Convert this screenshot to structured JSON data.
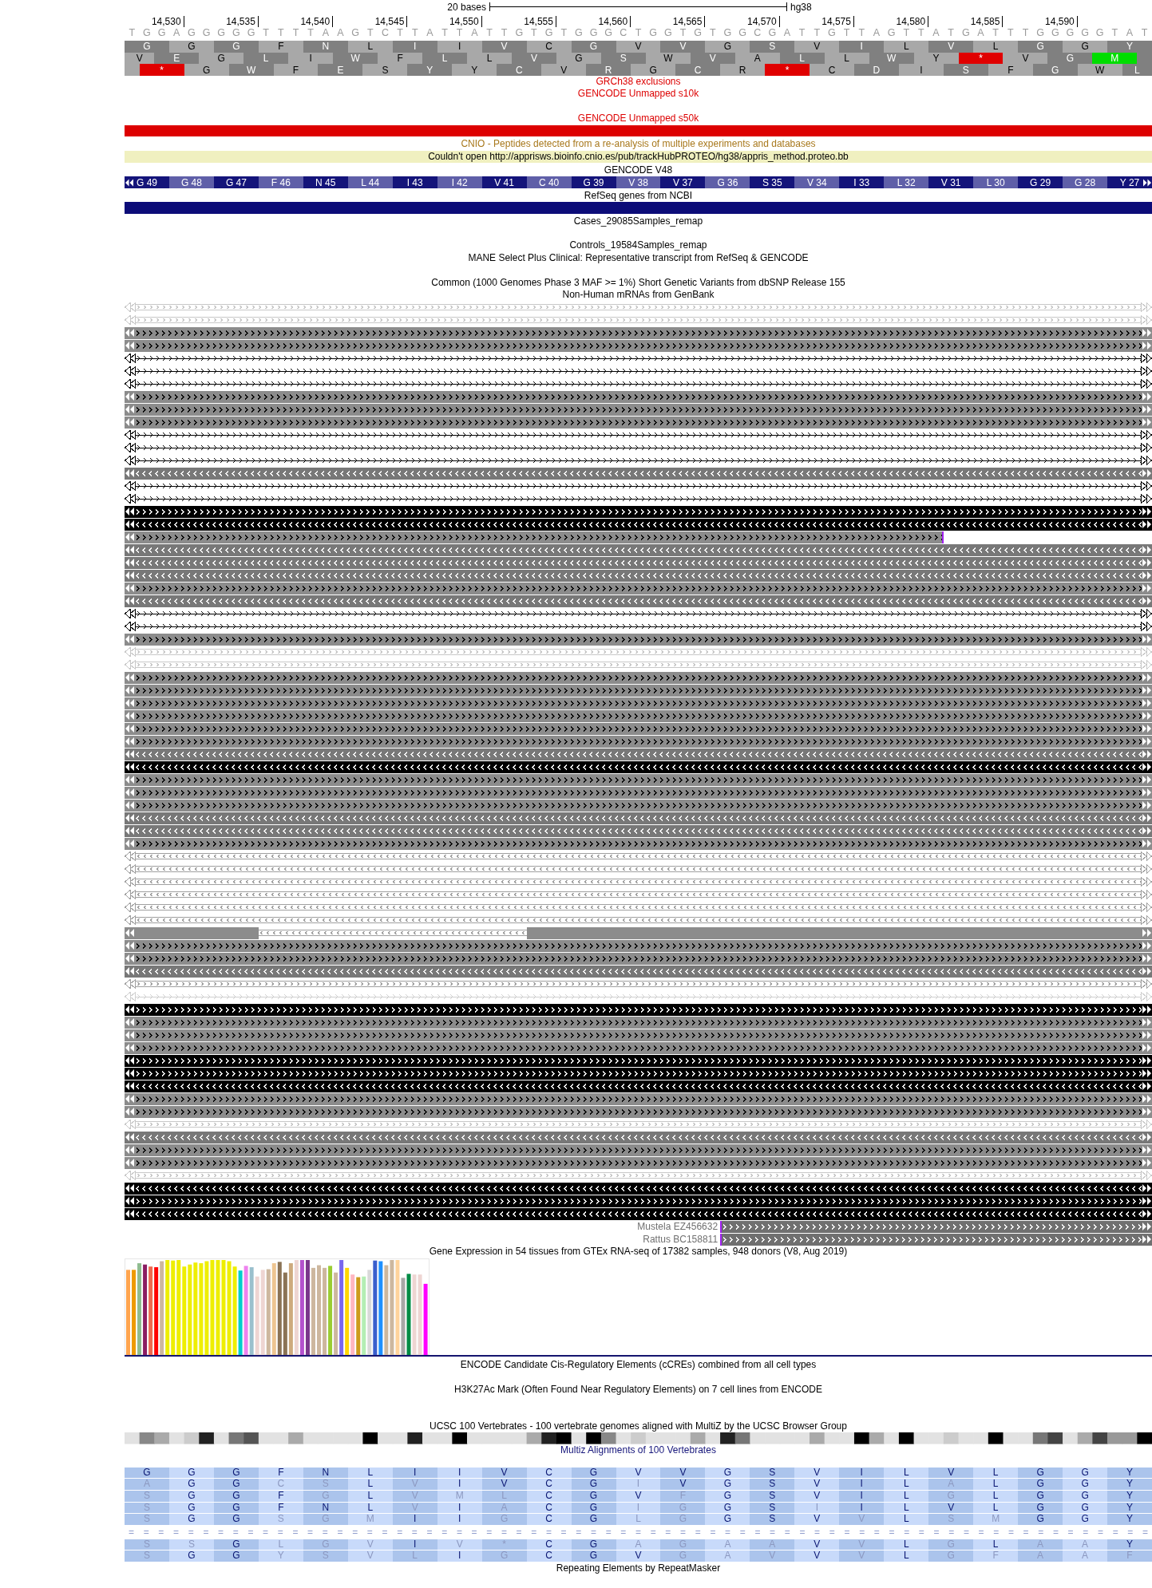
{
  "scale": {
    "label": "20 bases",
    "assembly": "hg38"
  },
  "ruler": [
    "14,530",
    "14,535",
    "14,540",
    "14,545",
    "14,550",
    "14,555",
    "14,560",
    "14,565",
    "14,570",
    "14,575",
    "14,580",
    "14,585",
    "14,590"
  ],
  "sequence": [
    "T",
    "G",
    "G",
    "A",
    "G",
    "G",
    "G",
    "G",
    "G",
    "T",
    "T",
    "T",
    "T",
    "A",
    "A",
    "G",
    "T",
    "C",
    "T",
    "T",
    "A",
    "T",
    "T",
    "A",
    "T",
    "T",
    "G",
    "T",
    "G",
    "T",
    "G",
    "G",
    "G",
    "C",
    "T",
    "G",
    "G",
    "T",
    "G",
    "T",
    "G",
    "G",
    "C",
    "G",
    "A",
    "T",
    "T",
    "G",
    "T",
    "T",
    "A",
    "G",
    "T",
    "T",
    "A",
    "T",
    "G",
    "A",
    "T",
    "T",
    "T",
    "G",
    "G",
    "G",
    "G",
    "G",
    "T",
    "A",
    "T"
  ],
  "frames": [
    {
      "codons": [
        {
          "aa": "G",
          "kind": "codon"
        },
        {
          "aa": "G",
          "kind": "codon"
        },
        {
          "aa": "G",
          "kind": "codon"
        },
        {
          "aa": "F",
          "kind": "codon"
        },
        {
          "aa": "N",
          "kind": "codon"
        },
        {
          "aa": "L",
          "kind": "codon"
        },
        {
          "aa": "I",
          "kind": "codon"
        },
        {
          "aa": "I",
          "kind": "codon"
        },
        {
          "aa": "V",
          "kind": "codon"
        },
        {
          "aa": "C",
          "kind": "codon"
        },
        {
          "aa": "G",
          "kind": "codon"
        },
        {
          "aa": "V",
          "kind": "codon"
        },
        {
          "aa": "V",
          "kind": "codon"
        },
        {
          "aa": "G",
          "kind": "codon"
        },
        {
          "aa": "S",
          "kind": "codon"
        },
        {
          "aa": "V",
          "kind": "codon"
        },
        {
          "aa": "I",
          "kind": "codon"
        },
        {
          "aa": "L",
          "kind": "codon"
        },
        {
          "aa": "V",
          "kind": "codon"
        },
        {
          "aa": "L",
          "kind": "codon"
        },
        {
          "aa": "G",
          "kind": "codon"
        },
        {
          "aa": "G",
          "kind": "codon"
        },
        {
          "aa": "Y",
          "kind": "codon"
        }
      ]
    },
    {
      "codons": [
        {
          "aa": "V",
          "kind": "partial"
        },
        {
          "aa": "E",
          "kind": "codon"
        },
        {
          "aa": "G",
          "kind": "codon"
        },
        {
          "aa": "L",
          "kind": "codon"
        },
        {
          "aa": "I",
          "kind": "codon"
        },
        {
          "aa": "W",
          "kind": "codon"
        },
        {
          "aa": "F",
          "kind": "codon"
        },
        {
          "aa": "L",
          "kind": "codon"
        },
        {
          "aa": "L",
          "kind": "codon"
        },
        {
          "aa": "V",
          "kind": "codon"
        },
        {
          "aa": "G",
          "kind": "codon"
        },
        {
          "aa": "S",
          "kind": "codon"
        },
        {
          "aa": "W",
          "kind": "codon"
        },
        {
          "aa": "V",
          "kind": "codon"
        },
        {
          "aa": "A",
          "kind": "codon"
        },
        {
          "aa": "L",
          "kind": "codon"
        },
        {
          "aa": "L",
          "kind": "codon"
        },
        {
          "aa": "W",
          "kind": "codon"
        },
        {
          "aa": "Y",
          "kind": "codon"
        },
        {
          "aa": "*",
          "kind": "stop"
        },
        {
          "aa": "V",
          "kind": "codon"
        },
        {
          "aa": "G",
          "kind": "codon"
        },
        {
          "aa": "M",
          "kind": "start"
        },
        {
          "kind": "partial"
        }
      ]
    },
    {
      "codons": [
        {
          "kind": "partial"
        },
        {
          "aa": "*",
          "kind": "stop"
        },
        {
          "aa": "G",
          "kind": "codon"
        },
        {
          "aa": "W",
          "kind": "codon"
        },
        {
          "aa": "F",
          "kind": "codon"
        },
        {
          "aa": "E",
          "kind": "codon"
        },
        {
          "aa": "S",
          "kind": "codon"
        },
        {
          "aa": "Y",
          "kind": "codon"
        },
        {
          "aa": "Y",
          "kind": "codon"
        },
        {
          "aa": "C",
          "kind": "codon"
        },
        {
          "aa": "V",
          "kind": "codon"
        },
        {
          "aa": "R",
          "kind": "codon"
        },
        {
          "aa": "G",
          "kind": "codon"
        },
        {
          "aa": "C",
          "kind": "codon"
        },
        {
          "aa": "R",
          "kind": "codon"
        },
        {
          "aa": "*",
          "kind": "stop"
        },
        {
          "aa": "C",
          "kind": "codon"
        },
        {
          "aa": "D",
          "kind": "codon"
        },
        {
          "aa": "I",
          "kind": "codon"
        },
        {
          "aa": "S",
          "kind": "codon"
        },
        {
          "aa": "F",
          "kind": "codon"
        },
        {
          "aa": "G",
          "kind": "codon"
        },
        {
          "aa": "W",
          "kind": "codon"
        },
        {
          "aa": "L",
          "kind": "partial"
        }
      ]
    }
  ],
  "tracks": [
    {
      "kind": "label",
      "title": "GRCh38 exclusions",
      "color": "#dd0000"
    },
    {
      "kind": "label",
      "title": "GENCODE Unmapped s10k",
      "color": "#dd0000"
    },
    {
      "kind": "spacer"
    },
    {
      "kind": "label",
      "title": "GENCODE Unmapped s50k",
      "color": "#dd0000"
    },
    {
      "kind": "bar",
      "color": "#dd0000"
    },
    {
      "kind": "label",
      "title": "CNIO - Peptides detected from a re-analysis of multiple experiments and databases",
      "color": "#a8781c"
    },
    {
      "kind": "message",
      "text": "Couldn't open http://apprisws.bioinfo.cnio.es/pub/trackHubPROTEO/hg38/appris_method.proteo.bb"
    },
    {
      "kind": "label",
      "title": "GENCODE V48",
      "color": "#000000"
    },
    {
      "kind": "codons",
      "codons": [
        {
          "label": "G 49"
        },
        {
          "label": "G 48"
        },
        {
          "label": "G 47"
        },
        {
          "label": "F 46"
        },
        {
          "label": "N 45"
        },
        {
          "label": "L 44"
        },
        {
          "label": "I 43"
        },
        {
          "label": "I 42"
        },
        {
          "label": "V 41"
        },
        {
          "label": "C 40"
        },
        {
          "label": "G 39"
        },
        {
          "label": "V 38"
        },
        {
          "label": "V 37"
        },
        {
          "label": "G 36"
        },
        {
          "label": "S 35"
        },
        {
          "label": "V 34"
        },
        {
          "label": "I 33"
        },
        {
          "label": "L 32"
        },
        {
          "label": "V 31"
        },
        {
          "label": "L 30"
        },
        {
          "label": "G 29"
        },
        {
          "label": "G 28"
        },
        {
          "label": "Y 27"
        }
      ]
    },
    {
      "kind": "label",
      "title": "RefSeq genes from NCBI",
      "color": "#000000"
    },
    {
      "kind": "bar",
      "color": "#0c0c78"
    },
    {
      "kind": "label",
      "title": "Cases_29085Samples_remap",
      "color": "#000000"
    },
    {
      "kind": "spacer"
    },
    {
      "kind": "label",
      "title": "Controls_19584Samples_remap",
      "color": "#000000"
    },
    {
      "kind": "label",
      "title": "MANE Select Plus Clinical: Representative transcript from RefSeq & GENCODE",
      "color": "#000000"
    },
    {
      "kind": "spacer"
    },
    {
      "kind": "label",
      "title": "Common (1000 Genomes Phase 3 MAF >= 1%) Short Genetic Variants from dbSNP Release 155",
      "color": "#000000"
    },
    {
      "kind": "label",
      "title": "Non-Human mRNAs from GenBank",
      "color": "#000000"
    },
    {
      "kind": "alignments",
      "rows": [
        {
          "kind": "outline",
          "color": "#c8c8c8",
          "reverse": false
        },
        {
          "kind": "outline",
          "color": "#c8c8c8",
          "reverse": false
        },
        {
          "kind": "block",
          "color": "#8c8c8c",
          "reverse": false
        },
        {
          "kind": "block",
          "color": "#8c8c8c",
          "reverse": false
        },
        {
          "kind": "line",
          "color": "#000000",
          "reverse": false
        },
        {
          "kind": "line",
          "color": "#000000",
          "reverse": false
        },
        {
          "kind": "line",
          "color": "#000000",
          "reverse": false
        },
        {
          "kind": "block",
          "color": "#8c8c8c",
          "reverse": false
        },
        {
          "kind": "block",
          "color": "#8c8c8c",
          "reverse": false
        },
        {
          "kind": "block",
          "color": "#8c8c8c",
          "reverse": false
        },
        {
          "kind": "line",
          "color": "#000000",
          "reverse": false
        },
        {
          "kind": "line",
          "color": "#000000",
          "reverse": false
        },
        {
          "kind": "line",
          "color": "#000000",
          "reverse": false
        },
        {
          "kind": "block",
          "color": "#787878",
          "reverse": true
        },
        {
          "kind": "line",
          "color": "#000000",
          "reverse": false
        },
        {
          "kind": "line",
          "color": "#000000",
          "reverse": false
        },
        {
          "kind": "block",
          "color": "#000000",
          "reverse": false
        },
        {
          "kind": "block",
          "color": "#000000",
          "reverse": true
        },
        {
          "kind": "ending",
          "color": "#8c8c8c",
          "reverse": false
        },
        {
          "kind": "block",
          "color": "#787878",
          "reverse": true
        },
        {
          "kind": "block",
          "color": "#787878",
          "reverse": true
        },
        {
          "kind": "block",
          "color": "#787878",
          "reverse": true
        },
        {
          "kind": "block",
          "color": "#8c8c8c",
          "reverse": false
        },
        {
          "kind": "block",
          "color": "#787878",
          "reverse": true
        },
        {
          "kind": "line",
          "color": "#000000",
          "reverse": false
        },
        {
          "kind": "line",
          "color": "#000000",
          "reverse": false
        },
        {
          "kind": "block",
          "color": "#8c8c8c",
          "reverse": false
        },
        {
          "kind": "outline",
          "color": "#c8c8c8",
          "reverse": false
        },
        {
          "kind": "outline",
          "color": "#c8c8c8",
          "reverse": false
        },
        {
          "kind": "block",
          "color": "#8c8c8c",
          "reverse": false
        },
        {
          "kind": "block",
          "color": "#8c8c8c",
          "reverse": false
        },
        {
          "kind": "block",
          "color": "#8c8c8c",
          "reverse": false
        },
        {
          "kind": "block",
          "color": "#8c8c8c",
          "reverse": false
        },
        {
          "kind": "block",
          "color": "#8c8c8c",
          "reverse": false
        },
        {
          "kind": "block",
          "color": "#8c8c8c",
          "reverse": false
        },
        {
          "kind": "block",
          "color": "#787878",
          "reverse": true
        },
        {
          "kind": "block",
          "color": "#000000",
          "reverse": true
        },
        {
          "kind": "block",
          "color": "#8c8c8c",
          "reverse": false
        },
        {
          "kind": "block",
          "color": "#8c8c8c",
          "reverse": false
        },
        {
          "kind": "block",
          "color": "#8c8c8c",
          "reverse": false
        },
        {
          "kind": "block",
          "color": "#787878",
          "reverse": true
        },
        {
          "kind": "block",
          "color": "#787878",
          "reverse": true
        },
        {
          "kind": "block",
          "color": "#8c8c8c",
          "reverse": false
        },
        {
          "kind": "outline",
          "color": "#a0a0a0",
          "reverse": true
        },
        {
          "kind": "outline",
          "color": "#a0a0a0",
          "reverse": true
        },
        {
          "kind": "outline",
          "color": "#a0a0a0",
          "reverse": true
        },
        {
          "kind": "outline",
          "color": "#a0a0a0",
          "reverse": true
        },
        {
          "kind": "outline",
          "color": "#a0a0a0",
          "reverse": true
        },
        {
          "kind": "outline",
          "color": "#a0a0a0",
          "reverse": true
        },
        {
          "kind": "gapped",
          "segments": [
            {
              "kind": "solid",
              "color": "#8c8c8c"
            },
            {
              "kind": "outline",
              "color": "#a0a0a0",
              "reverse": true
            },
            {
              "kind": "solid",
              "color": "#8c8c8c"
            }
          ]
        },
        {
          "kind": "block",
          "color": "#8c8c8c",
          "reverse": false
        },
        {
          "kind": "block",
          "color": "#8c8c8c",
          "reverse": false
        },
        {
          "kind": "block",
          "color": "#787878",
          "reverse": true
        },
        {
          "kind": "outline",
          "color": "#a0a0a0",
          "reverse": false
        },
        {
          "kind": "line",
          "color": "#d0d0d0",
          "reverse": false
        },
        {
          "kind": "block",
          "color": "#000000",
          "reverse": false
        },
        {
          "kind": "block",
          "color": "#8c8c8c",
          "reverse": false
        },
        {
          "kind": "block",
          "color": "#8c8c8c",
          "reverse": false
        },
        {
          "kind": "block",
          "color": "#8c8c8c",
          "reverse": false
        },
        {
          "kind": "block",
          "color": "#000000",
          "reverse": false
        },
        {
          "kind": "block",
          "color": "#000000",
          "reverse": false
        },
        {
          "kind": "block",
          "color": "#000000",
          "reverse": true
        },
        {
          "kind": "block",
          "color": "#8c8c8c",
          "reverse": false
        },
        {
          "kind": "block",
          "color": "#8c8c8c",
          "reverse": false
        },
        {
          "kind": "outline",
          "color": "#c8c8c8",
          "reverse": false
        },
        {
          "kind": "block",
          "color": "#787878",
          "reverse": true
        },
        {
          "kind": "block",
          "color": "#8c8c8c",
          "reverse": false
        },
        {
          "kind": "block",
          "color": "#8c8c8c",
          "reverse": false
        },
        {
          "kind": "outline",
          "color": "#c8c8c8",
          "reverse": false
        },
        {
          "kind": "block",
          "color": "#000000",
          "reverse": true
        },
        {
          "kind": "block",
          "color": "#000000",
          "reverse": false
        },
        {
          "kind": "block",
          "color": "#000000",
          "reverse": true
        },
        {
          "kind": "labeled",
          "label": "Mustela EZ456632",
          "color": "#707070",
          "reverse": false
        },
        {
          "kind": "labeled",
          "label": "Rattus BC158811",
          "color": "#707070",
          "reverse": false
        }
      ]
    },
    {
      "kind": "label",
      "title": "Gene Expression in 54 tissues from GTEx RNA-seq of 17382 samples, 948 donors (V8, Aug 2019)",
      "color": "#000000"
    },
    {
      "kind": "expression"
    },
    {
      "kind": "label",
      "title": "ENCODE Candidate Cis-Regulatory Elements (cCREs) combined from all cell types",
      "color": "#000000"
    },
    {
      "kind": "spacer"
    },
    {
      "kind": "label",
      "title": "H3K27Ac Mark (Often Found Near Regulatory Elements) on 7 cell lines from ENCODE",
      "color": "#000000"
    },
    {
      "kind": "spacer"
    },
    {
      "kind": "spacer"
    },
    {
      "kind": "label",
      "title": "UCSC 100 Vertebrates - 100 vertebrate genomes aligned with MultiZ by the UCSC Browser Group",
      "color": "#000000"
    },
    {
      "kind": "density"
    },
    {
      "kind": "label",
      "title": "Multiz Alignments of 100 Vertebrates",
      "color": "#14147a"
    },
    {
      "kind": "multiz",
      "rows": [
        {
          "kind": "residues",
          "cells": [
            {
              "aa": "G",
              "match": true
            },
            {
              "aa": "G",
              "match": true
            },
            {
              "aa": "G",
              "match": true
            },
            {
              "aa": "F",
              "match": true
            },
            {
              "aa": "N",
              "match": true
            },
            {
              "aa": "L",
              "match": true
            },
            {
              "aa": "I",
              "match": true
            },
            {
              "aa": "I",
              "match": true
            },
            {
              "aa": "V",
              "match": true
            },
            {
              "aa": "C",
              "match": true
            },
            {
              "aa": "G",
              "match": true
            },
            {
              "aa": "V",
              "match": true
            },
            {
              "aa": "V",
              "match": true
            },
            {
              "aa": "G",
              "match": true
            },
            {
              "aa": "S",
              "match": true
            },
            {
              "aa": "V",
              "match": true
            },
            {
              "aa": "I",
              "match": true
            },
            {
              "aa": "L",
              "match": true
            },
            {
              "aa": "V",
              "match": true
            },
            {
              "aa": "L",
              "match": true
            },
            {
              "aa": "G",
              "match": true
            },
            {
              "aa": "G",
              "match": true
            },
            {
              "aa": "Y",
              "match": true
            }
          ]
        },
        {
          "kind": "residues",
          "cells": [
            {
              "aa": "A",
              "match": false
            },
            {
              "aa": "G",
              "match": true
            },
            {
              "aa": "G",
              "match": true
            },
            {
              "aa": "C",
              "match": false
            },
            {
              "aa": "S",
              "match": false
            },
            {
              "aa": "L",
              "match": true
            },
            {
              "aa": "V",
              "match": false
            },
            {
              "aa": "I",
              "match": true
            },
            {
              "aa": "V",
              "match": true
            },
            {
              "aa": "C",
              "match": true
            },
            {
              "aa": "G",
              "match": true
            },
            {
              "aa": "I",
              "match": false
            },
            {
              "aa": "V",
              "match": true
            },
            {
              "aa": "G",
              "match": true
            },
            {
              "aa": "S",
              "match": true
            },
            {
              "aa": "V",
              "match": true
            },
            {
              "aa": "I",
              "match": true
            },
            {
              "aa": "L",
              "match": true
            },
            {
              "aa": "A",
              "match": false
            },
            {
              "aa": "L",
              "match": true
            },
            {
              "aa": "G",
              "match": true
            },
            {
              "aa": "G",
              "match": true
            },
            {
              "aa": "Y",
              "match": true
            }
          ]
        },
        {
          "kind": "residues",
          "cells": [
            {
              "aa": "S",
              "match": false
            },
            {
              "aa": "G",
              "match": true
            },
            {
              "aa": "G",
              "match": true
            },
            {
              "aa": "F",
              "match": true
            },
            {
              "aa": "G",
              "match": false
            },
            {
              "aa": "L",
              "match": true
            },
            {
              "aa": "V",
              "match": false
            },
            {
              "aa": "M",
              "match": false
            },
            {
              "aa": "L",
              "match": false
            },
            {
              "aa": "C",
              "match": true
            },
            {
              "aa": "G",
              "match": true
            },
            {
              "aa": "V",
              "match": true
            },
            {
              "aa": "F",
              "match": false
            },
            {
              "aa": "G",
              "match": true
            },
            {
              "aa": "S",
              "match": true
            },
            {
              "aa": "V",
              "match": true
            },
            {
              "aa": "I",
              "match": true
            },
            {
              "aa": "L",
              "match": true
            },
            {
              "aa": "G",
              "match": false
            },
            {
              "aa": "L",
              "match": true
            },
            {
              "aa": "G",
              "match": true
            },
            {
              "aa": "G",
              "match": true
            },
            {
              "aa": "Y",
              "match": true
            }
          ]
        },
        {
          "kind": "residues",
          "cells": [
            {
              "aa": "S",
              "match": false
            },
            {
              "aa": "G",
              "match": true
            },
            {
              "aa": "G",
              "match": true
            },
            {
              "aa": "F",
              "match": true
            },
            {
              "aa": "N",
              "match": true
            },
            {
              "aa": "L",
              "match": true
            },
            {
              "aa": "V",
              "match": false
            },
            {
              "aa": "I",
              "match": true
            },
            {
              "aa": "A",
              "match": false
            },
            {
              "aa": "C",
              "match": true
            },
            {
              "aa": "G",
              "match": true
            },
            {
              "aa": "I",
              "match": false
            },
            {
              "aa": "G",
              "match": false
            },
            {
              "aa": "G",
              "match": true
            },
            {
              "aa": "S",
              "match": true
            },
            {
              "aa": "I",
              "match": false
            },
            {
              "aa": "I",
              "match": true
            },
            {
              "aa": "L",
              "match": true
            },
            {
              "aa": "V",
              "match": true
            },
            {
              "aa": "L",
              "match": true
            },
            {
              "aa": "G",
              "match": true
            },
            {
              "aa": "G",
              "match": true
            },
            {
              "aa": "Y",
              "match": true
            }
          ]
        },
        {
          "kind": "residues",
          "cells": [
            {
              "aa": "S",
              "match": false
            },
            {
              "aa": "G",
              "match": true
            },
            {
              "aa": "G",
              "match": true
            },
            {
              "aa": "S",
              "match": false
            },
            {
              "aa": "G",
              "match": false
            },
            {
              "aa": "M",
              "match": false
            },
            {
              "aa": "I",
              "match": true
            },
            {
              "aa": "I",
              "match": true
            },
            {
              "aa": "G",
              "match": false
            },
            {
              "aa": "C",
              "match": true
            },
            {
              "aa": "G",
              "match": true
            },
            {
              "aa": "L",
              "match": false
            },
            {
              "aa": "G",
              "match": false
            },
            {
              "aa": "G",
              "match": true
            },
            {
              "aa": "S",
              "match": true
            },
            {
              "aa": "V",
              "match": true
            },
            {
              "aa": "V",
              "match": false
            },
            {
              "aa": "L",
              "match": true
            },
            {
              "aa": "S",
              "match": false
            },
            {
              "aa": "M",
              "match": false
            },
            {
              "aa": "G",
              "match": true
            },
            {
              "aa": "G",
              "match": true
            },
            {
              "aa": "Y",
              "match": true
            }
          ]
        },
        {
          "kind": "gaps",
          "text": "= = = = = = = = = = = = = = = = = = = = = = = = = = = = = = = = = = = = = = = = = = = = = = = = = = = = = = = = = = = = = = = = = = = = ="
        },
        {
          "kind": "residues",
          "cells": [
            {
              "aa": "S",
              "match": false
            },
            {
              "aa": "S",
              "match": false
            },
            {
              "aa": "G",
              "match": true
            },
            {
              "aa": "L",
              "match": false
            },
            {
              "aa": "G",
              "match": false
            },
            {
              "aa": "V",
              "match": false
            },
            {
              "aa": "I",
              "match": true
            },
            {
              "aa": "V",
              "match": false
            },
            {
              "aa": "*",
              "match": false
            },
            {
              "aa": "C",
              "match": true
            },
            {
              "aa": "G",
              "match": true
            },
            {
              "aa": "A",
              "match": false
            },
            {
              "aa": "G",
              "match": false
            },
            {
              "aa": "A",
              "match": false
            },
            {
              "aa": "A",
              "match": false
            },
            {
              "aa": "V",
              "match": true
            },
            {
              "aa": "V",
              "match": false
            },
            {
              "aa": "L",
              "match": true
            },
            {
              "aa": "G",
              "match": false
            },
            {
              "aa": "L",
              "match": true
            },
            {
              "aa": "A",
              "match": false
            },
            {
              "aa": "A",
              "match": false
            },
            {
              "aa": "Y",
              "match": true
            }
          ]
        },
        {
          "kind": "residues",
          "cells": [
            {
              "aa": "S",
              "match": false
            },
            {
              "aa": "G",
              "match": true
            },
            {
              "aa": "G",
              "match": true
            },
            {
              "aa": "Y",
              "match": false
            },
            {
              "aa": "S",
              "match": false
            },
            {
              "aa": "V",
              "match": false
            },
            {
              "aa": "L",
              "match": false
            },
            {
              "aa": "I",
              "match": true
            },
            {
              "aa": "G",
              "match": false
            },
            {
              "aa": "C",
              "match": true
            },
            {
              "aa": "G",
              "match": true
            },
            {
              "aa": "V",
              "match": true
            },
            {
              "aa": "G",
              "match": false
            },
            {
              "aa": "A",
              "match": false
            },
            {
              "aa": "V",
              "match": false
            },
            {
              "aa": "V",
              "match": true
            },
            {
              "aa": "V",
              "match": false
            },
            {
              "aa": "L",
              "match": true
            },
            {
              "aa": "G",
              "match": false
            },
            {
              "aa": "F",
              "match": false
            },
            {
              "aa": "A",
              "match": false
            },
            {
              "aa": "A",
              "match": false
            },
            {
              "aa": "F",
              "match": false
            }
          ]
        }
      ]
    },
    {
      "kind": "label",
      "title": "Repeating Elements by RepeatMasker",
      "color": "#000000"
    }
  ]
}
